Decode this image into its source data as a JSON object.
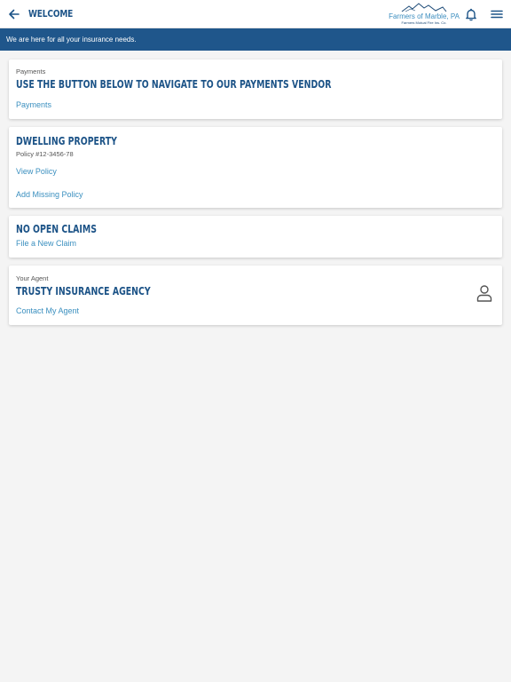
{
  "header": {
    "title": "WELCOME",
    "logo_text": "Farmers of Marble, PA",
    "logo_subtext": "Farmers Mutual Fire Ins. Co.",
    "icons": [
      "back-arrow-icon",
      "bell-icon",
      "hamburger-menu-icon"
    ]
  },
  "banner": {
    "text": "We are here for all your insurance needs."
  },
  "payments_card": {
    "label": "Payments",
    "heading": "USE THE BUTTON BELOW TO NAVIGATE TO OUR PAYMENTS VENDOR",
    "link": "Payments"
  },
  "policy_card": {
    "heading": "DWELLING PROPERTY",
    "policy_number": "Policy #12-3456-78",
    "view_link": "View Policy",
    "add_link": "Add Missing Policy"
  },
  "claims_card": {
    "heading": "NO OPEN CLAIMS",
    "link": "File a New Claim"
  },
  "agent_card": {
    "label": "Your Agent",
    "heading": "TRUSTY INSURANCE AGENCY",
    "link": "Contact My Agent",
    "icon": "person-icon"
  },
  "colors": {
    "brand_dark_blue": "#1c5387",
    "banner_blue": "#1f568b",
    "link_blue": "#3a8fbf",
    "background": "#f4f4f4"
  }
}
